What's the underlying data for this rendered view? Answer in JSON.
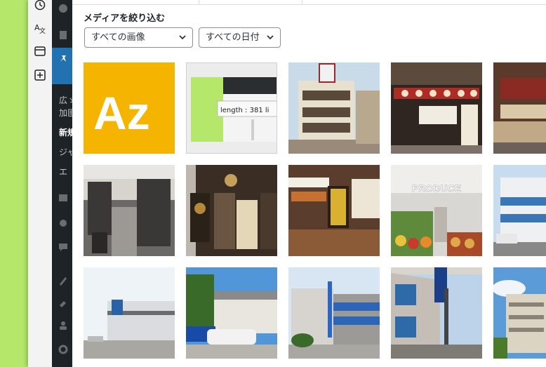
{
  "toolstrip": {
    "icons": [
      "history-icon",
      "translate-icon",
      "window-icon",
      "new-tab-icon"
    ]
  },
  "admin_sidebar": {
    "partial_labels": [
      "広ゞ",
      "加匪",
      "新規",
      "ジャ",
      "エ"
    ]
  },
  "media_filter": {
    "label": "メディアを絞り込む",
    "type_select": {
      "value": "すべての画像"
    },
    "date_select": {
      "value": "すべての日付"
    }
  },
  "thumbnails": [
    {
      "name": "az-logo-thumb",
      "text": "Az",
      "bg": "#f5b400"
    },
    {
      "name": "screenshot-thumb",
      "text": "length : 381   li"
    },
    {
      "name": "japanese-building-thumb",
      "text": ""
    },
    {
      "name": "shop-front-thumb",
      "text": ""
    },
    {
      "name": "shop-front-partial-thumb",
      "text": ""
    },
    {
      "name": "restaurant-interior-thumb",
      "text": ""
    },
    {
      "name": "restaurant-entrance-thumb",
      "text": ""
    },
    {
      "name": "deli-counter-thumb",
      "text": ""
    },
    {
      "name": "produce-market-thumb",
      "text": "PRODUCE"
    },
    {
      "name": "office-building-thumb",
      "text": ""
    },
    {
      "name": "warehouse-thumb",
      "text": ""
    },
    {
      "name": "showroom-thumb",
      "text": ""
    },
    {
      "name": "office-building-2-thumb",
      "text": ""
    },
    {
      "name": "office-building-3-thumb",
      "text": ""
    },
    {
      "name": "apartment-building-thumb",
      "text": ""
    }
  ]
}
